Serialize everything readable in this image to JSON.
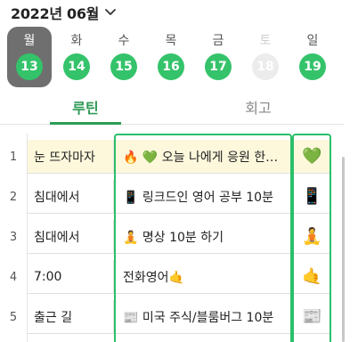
{
  "header": {
    "month_title": "2022년 06월"
  },
  "week": [
    {
      "label": "월",
      "date": "13",
      "state": "selected"
    },
    {
      "label": "화",
      "date": "14",
      "state": "normal"
    },
    {
      "label": "수",
      "date": "15",
      "state": "normal"
    },
    {
      "label": "목",
      "date": "16",
      "state": "normal"
    },
    {
      "label": "금",
      "date": "17",
      "state": "normal"
    },
    {
      "label": "토",
      "date": "18",
      "state": "faded"
    },
    {
      "label": "일",
      "date": "19",
      "state": "normal"
    }
  ],
  "tabs": [
    {
      "label": "루틴",
      "active": true
    },
    {
      "label": "회고",
      "active": false
    }
  ],
  "rows": [
    {
      "num": "1",
      "trigger": "눈 뜨자마자",
      "routine": "🔥 💚 오늘 나에게 응원 한…",
      "emoji": "💚"
    },
    {
      "num": "2",
      "trigger": "침대에서",
      "routine": "📱 링크드인 영어 공부 10분",
      "emoji": "📱"
    },
    {
      "num": "3",
      "trigger": "침대에서",
      "routine": "🧘 명상 10분 하기",
      "emoji": "🧘"
    },
    {
      "num": "4",
      "trigger": "7:00",
      "routine": "전화영어🤙",
      "emoji": "🤙"
    },
    {
      "num": "5",
      "trigger": "출근 길",
      "routine": "📰 미국 주식/블룸버그 10분",
      "emoji": "📰"
    }
  ],
  "colors": {
    "accent_green": "#2e9b56",
    "date_green": "#34c36a",
    "highlight_row": "#fdf8dc",
    "selected_day_bg": "#6f6f6f"
  }
}
